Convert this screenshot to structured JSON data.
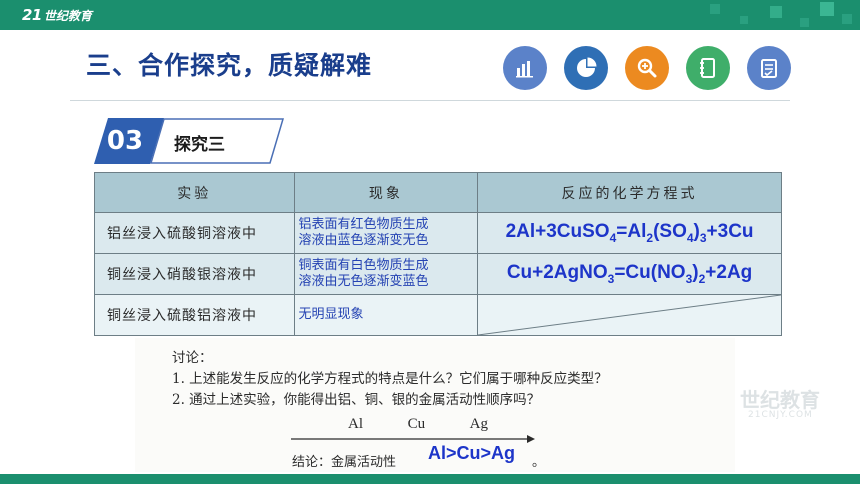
{
  "header": {
    "logo_mark": "21",
    "logo_text": "世纪教育",
    "bar_color": "#1b8f6e"
  },
  "slide": {
    "title": "三、合作探究，质疑解难",
    "section_number": "03",
    "section_label": "探究三"
  },
  "icons": [
    {
      "name": "bar-chart-icon",
      "color": "#5b82c9"
    },
    {
      "name": "pie-chart-icon",
      "color": "#2f6fb5"
    },
    {
      "name": "magnifier-icon",
      "color": "#ec8a20"
    },
    {
      "name": "notebook-icon",
      "color": "#3fae6a"
    },
    {
      "name": "checklist-icon",
      "color": "#5b82c9"
    }
  ],
  "table": {
    "headers": [
      "实验",
      "现象",
      "反应的化学方程式"
    ],
    "rows": [
      {
        "experiment": "铝丝浸入硫酸铜溶液中",
        "phenomenon_line1": "铝表面有红色物质生成",
        "phenomenon_line2": "溶液由蓝色逐渐变无色",
        "eq_parts": [
          "2Al+3CuSO",
          "4",
          "=Al",
          "2",
          "(SO",
          "4",
          ")",
          "3",
          "+3Cu"
        ]
      },
      {
        "experiment": "铜丝浸入硝酸银溶液中",
        "phenomenon_line1": "铜表面有白色物质生成",
        "phenomenon_line2": "溶液由无色逐渐变蓝色",
        "eq_parts": [
          "Cu+2AgNO",
          "3",
          "=Cu(NO",
          "3",
          ")",
          "2",
          "+2Ag"
        ]
      },
      {
        "experiment": "铜丝浸入硫酸铝溶液中",
        "phenomenon_line1": "无明显现象"
      }
    ]
  },
  "discussion": {
    "heading": "讨论：",
    "q1": "1. 上述能发生反应的化学方程式的特点是什么？它们属于哪种反应类型？",
    "q2": "2. 通过上述实验，你能得出铝、铜、银的金属活动性顺序吗？",
    "metals": [
      "Al",
      "Cu",
      "Ag"
    ],
    "conclusion_label": "结论：金属活动性",
    "answer": "Al>Cu>Ag",
    "period": "。"
  },
  "watermark": {
    "text": "世纪教育",
    "sub": "21CNJY.COM"
  }
}
